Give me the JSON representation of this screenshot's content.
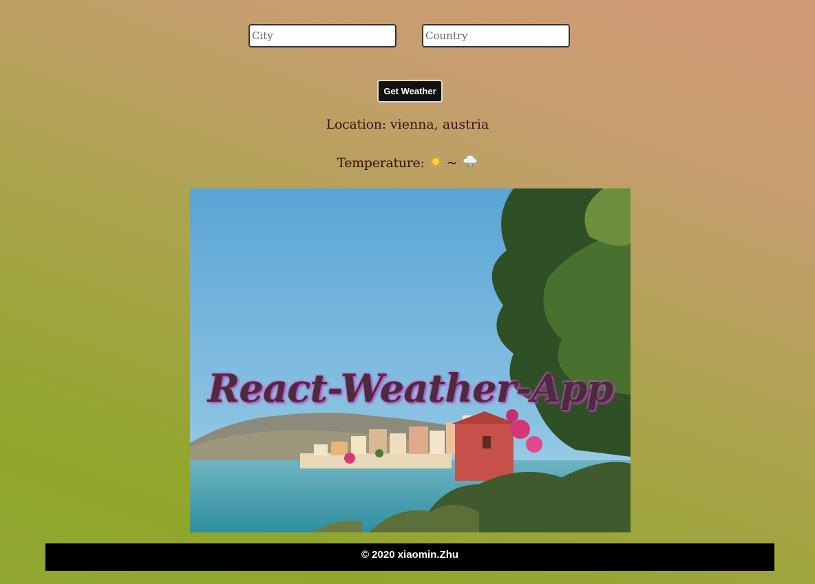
{
  "form": {
    "city_placeholder": "City",
    "city_value": "",
    "country_placeholder": "Country",
    "country_value": "",
    "submit_label": "Get Weather"
  },
  "result": {
    "location_label": "Location:",
    "location_value": "vienna, austria",
    "temperature_label": "Temperature:",
    "temperature_icon_left": "sun-icon",
    "temperature_separator": "~",
    "temperature_icon_right": "cloud-rain-icon"
  },
  "hero": {
    "banner_text": "React-Weather-App",
    "accent_color": "#c23bb8"
  },
  "footer": {
    "copyright": "© 2020 xiaomin.Zhu"
  }
}
